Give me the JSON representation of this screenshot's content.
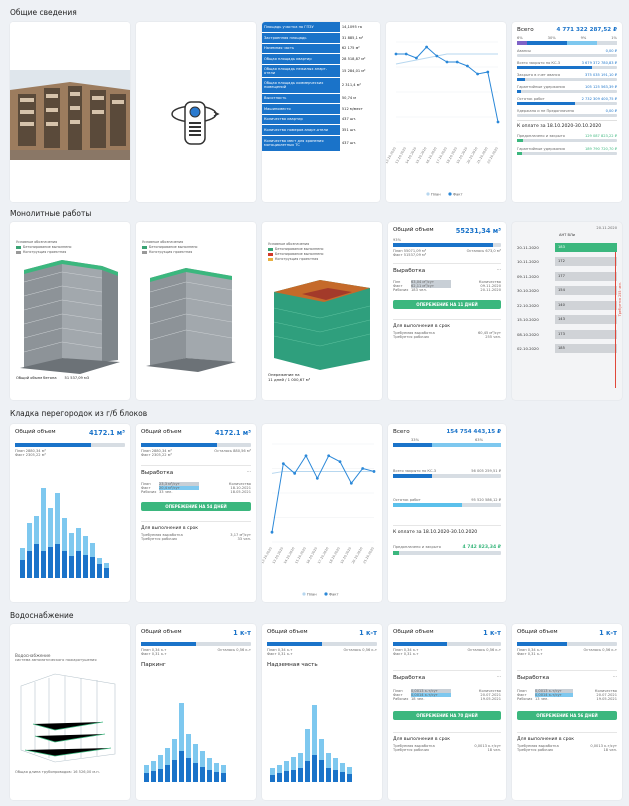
{
  "sections": {
    "general": "Общие сведения",
    "monolith": "Монолитные работы",
    "partitions": "Кладка перегородок из г/б блоков",
    "water": "Водоснабжение"
  },
  "properties": [
    {
      "k": "Площадь участка по ГПЗУ",
      "v": "14,1095 га"
    },
    {
      "k": "Застроенная площадь",
      "v": "31 885,1 м²"
    },
    {
      "k": "Наземная часть",
      "v": "62 175 м²"
    },
    {
      "k": "Общая площадь квартир",
      "v": "28 518,87 м²"
    },
    {
      "k": "Общая площадь нежилых апарт-отели",
      "v": "15 284,01 м²"
    },
    {
      "k": "Общая площадь коммерческих помещений",
      "v": "2 311,4 м²"
    },
    {
      "k": "Высотность",
      "v": "50,74 м"
    },
    {
      "k": "Машиноместо",
      "v": "512 м/мест"
    },
    {
      "k": "Количество квартир",
      "v": "437 шт."
    },
    {
      "k": "Количество номеров апарт-отели",
      "v": "351 шт."
    },
    {
      "k": "Количество мест для хранения мотоциклетных ТС",
      "v": "437 шт."
    }
  ],
  "finance": {
    "total_label": "Всего",
    "total_value": "4 771 322 287,52 ₽",
    "pct": [
      "6%",
      "30%",
      "9%",
      "1%"
    ],
    "lines": [
      {
        "label": "Авансы",
        "value": "0,00 ₽"
      },
      {
        "label": "Всего закрыто по КС-3",
        "value": "3 679 372 780,83 ₽"
      },
      {
        "label": "Закрыто в счет аванса",
        "value": "375 035 191,10 ₽"
      },
      {
        "label": "Гарантийные удержания",
        "value": "105 125 563,39 ₽"
      },
      {
        "label": "Остаток работ",
        "value": "2 732 309 400,75 ₽"
      },
      {
        "label": "Удержано и не Предоплачено",
        "value": "0,00 ₽"
      }
    ],
    "pay_title": "К оплате за 18.10.2020-30.10.2020",
    "pay_lines": [
      {
        "label": "Предоплачено и закрыто",
        "value": "129 087 823,22 ₽"
      },
      {
        "label": "Гарантийные удержания",
        "value": "189 790 720,70 ₽"
      }
    ]
  },
  "line_chart1": {
    "labels": [
      "12.10.2020",
      "13.10.2020",
      "14.10.2020",
      "15.10.2020",
      "16.10.2020",
      "17.10.2020",
      "18.10.2020",
      "19.10.2020",
      "20.10.2020",
      "21.10.2020",
      "22.10.2020"
    ],
    "legend": [
      "План",
      "Факт"
    ]
  },
  "monolith": {
    "legend_title": "Условные обозначения",
    "leg1": "Бетонирование выполнено",
    "leg2": "Бетонирование выполнено",
    "leg3": "Конструкция проектная",
    "caption1": "Общий объем бетона",
    "caption1_val": "51 537,09 м3",
    "caption3": "Опережение на",
    "caption3_val": "11 дней / 1 000,67 м³",
    "volume_title": "Общий объем",
    "volume_value": "55231,34 м³",
    "volume_pct": "93%",
    "plan": "План 55071,09 м³",
    "fact": "Факт 51537,09 м³",
    "remain": "Осталось 673,0 м³",
    "output_title": "Выработка",
    "out_plan": "Плн",
    "out_fact": "Факт",
    "out_workers": "Рабочих",
    "out_plan_val": "63,04 м³/сут",
    "out_fact_val": "62,11 м³/сут",
    "out_workers_val": "183 чел.",
    "out_right1": "Количество",
    "out_right2": "09.11.2020",
    "out_right3": "20.11.2020",
    "ahead_btn": "ОПЕРЕЖЕНИЕ НА 11 ДНЕЙ",
    "deadline_title": "Для выполнения в срок",
    "req_output": "Требуемая выработка",
    "req_workers": "Требуется рабочих",
    "req_output_val": "60,45 м³/сут",
    "req_workers_val": "255 чел."
  },
  "ant": {
    "date": "20.11.2020",
    "title": "АНТ ВЛи",
    "rows": [
      {
        "d": "20.11.2020",
        "v": "183"
      },
      {
        "d": "10.11.2020",
        "v": "172"
      },
      {
        "d": "09.11.2020",
        "v": "177"
      },
      {
        "d": "30.10.2020",
        "v": "154"
      },
      {
        "d": "22.10.2020",
        "v": "140"
      },
      {
        "d": "15.10.2020",
        "v": "143"
      },
      {
        "d": "08.10.2020",
        "v": "173"
      },
      {
        "d": "02.10.2020",
        "v": "185"
      }
    ],
    "side_label": "Требуется 255 чел."
  },
  "partitions": {
    "vol_title": "Общий объем",
    "vol_value": "4172.1 м³",
    "plan": "План 2880,34 м³",
    "fact": "Факт 2305,22 м³",
    "remain": "Осталось 880,56 м³",
    "vol2_value": "4172.1 м³",
    "output_title": "Выработка",
    "out_plan_val": "23,3 м³/сут",
    "out_fact_val": "20,4 м³/сут",
    "out_workers_val": "33 чел.",
    "out_right1": "Количество",
    "out_right2": "18.10.2021",
    "out_right3": "18.05.2021",
    "ahead_btn": "ОПЕРЕЖЕНИЕ НА 54 ДНЕЙ",
    "deadline_title": "Для выполнения в срок",
    "req_output_val": "3,17 м³/сут",
    "req_workers_val": "33 чел.",
    "fin_total": "Всего",
    "fin_value": "154 754 443,15 ₽",
    "fin_pct1": "33%",
    "fin_pct2": "63%",
    "fin_l1": "Всего закрыто по КС-3",
    "fin_v1": "56 005 259,51 ₽",
    "fin_l2": "Остаток работ",
    "fin_v2": "95 520 586,12 ₽",
    "pay_title": "К оплате за 18.10.2020-30.10.2020",
    "pay_l": "Предоплачено и закрыто",
    "pay_v": "4 742 823,34 ₽",
    "chart_legend": [
      "План",
      "Факт"
    ]
  },
  "water": {
    "img_title": "Водоснабжение",
    "img_sub": "система автоматического пожаротушения",
    "img_caption": "Общая длина трубопроводов: 16 526,00 м.п.",
    "vol_title": "Общий объем",
    "vol_value": "1 к-т",
    "plan": "План 0,34 к-т",
    "fact": "Факт 0,31 к-т",
    "remain": "Осталось 0,56 к-т",
    "parking": "Паркинг",
    "ground": "Надземная часть",
    "output_title": "Выработка",
    "out_val1": "0,0013 к-т/сут",
    "out_val2": "0,0014 к-т/сут",
    "out_workers1": "18 чел.",
    "out_workers2": "13 чел.",
    "out_right2": "20.07.2021",
    "out_right3": "19.05.2021",
    "ahead1": "ОПЕРЕЖЕНИЕ НА 70 ДНЕЙ",
    "ahead2": "ОПЕРЕЖЕНИЕ НА 56 ДНЕЙ",
    "deadline_title": "Для выполнения в срок",
    "req_output_val": "0,0013 к-т/сут",
    "req_workers_val": "18 чел."
  },
  "labels": {
    "plan": "План",
    "fact": "Факт",
    "workers": "Рабочих",
    "required_output": "Требуемая выработка",
    "required_workers": "Требуется рабочих",
    "quantity": "Количество"
  }
}
